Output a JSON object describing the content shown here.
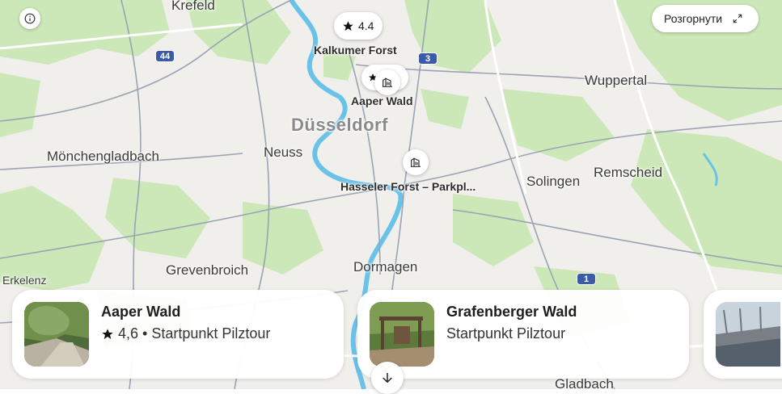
{
  "colors": {
    "land": "#f1efeb",
    "forest": "#cde8b8",
    "water": "#6bc2e8",
    "road": "#ffffff",
    "route": "#9aa3b4",
    "shield": "#3b5aa8"
  },
  "map": {
    "cities": [
      "Krefeld",
      "Mönchengladbach",
      "Neuss",
      "Düsseldorf",
      "Wuppertal",
      "Solingen",
      "Remscheid",
      "Grevenbroich",
      "Dormagen",
      "Erkelenz",
      "Gladbach"
    ],
    "highway_shields": [
      "44",
      "3",
      "1"
    ],
    "pois": [
      {
        "name": "Kalkumer Forst",
        "rating": "4.4"
      },
      {
        "name": "Aaper Wald"
      },
      {
        "name": "Hasseler Forst – Parkpl..."
      }
    ]
  },
  "controls": {
    "info_icon": "info-icon",
    "expand_label": "Розгорнути",
    "expand_icon": "expand-icon",
    "scroll_down_icon": "arrow-down-icon"
  },
  "cards": [
    {
      "title": "Aaper Wald",
      "rating": "4,6",
      "subtitle": "• Startpunkt Pilztour"
    },
    {
      "title": "Grafenberger Wald",
      "subtitle": "Startpunkt Pilztour"
    }
  ]
}
